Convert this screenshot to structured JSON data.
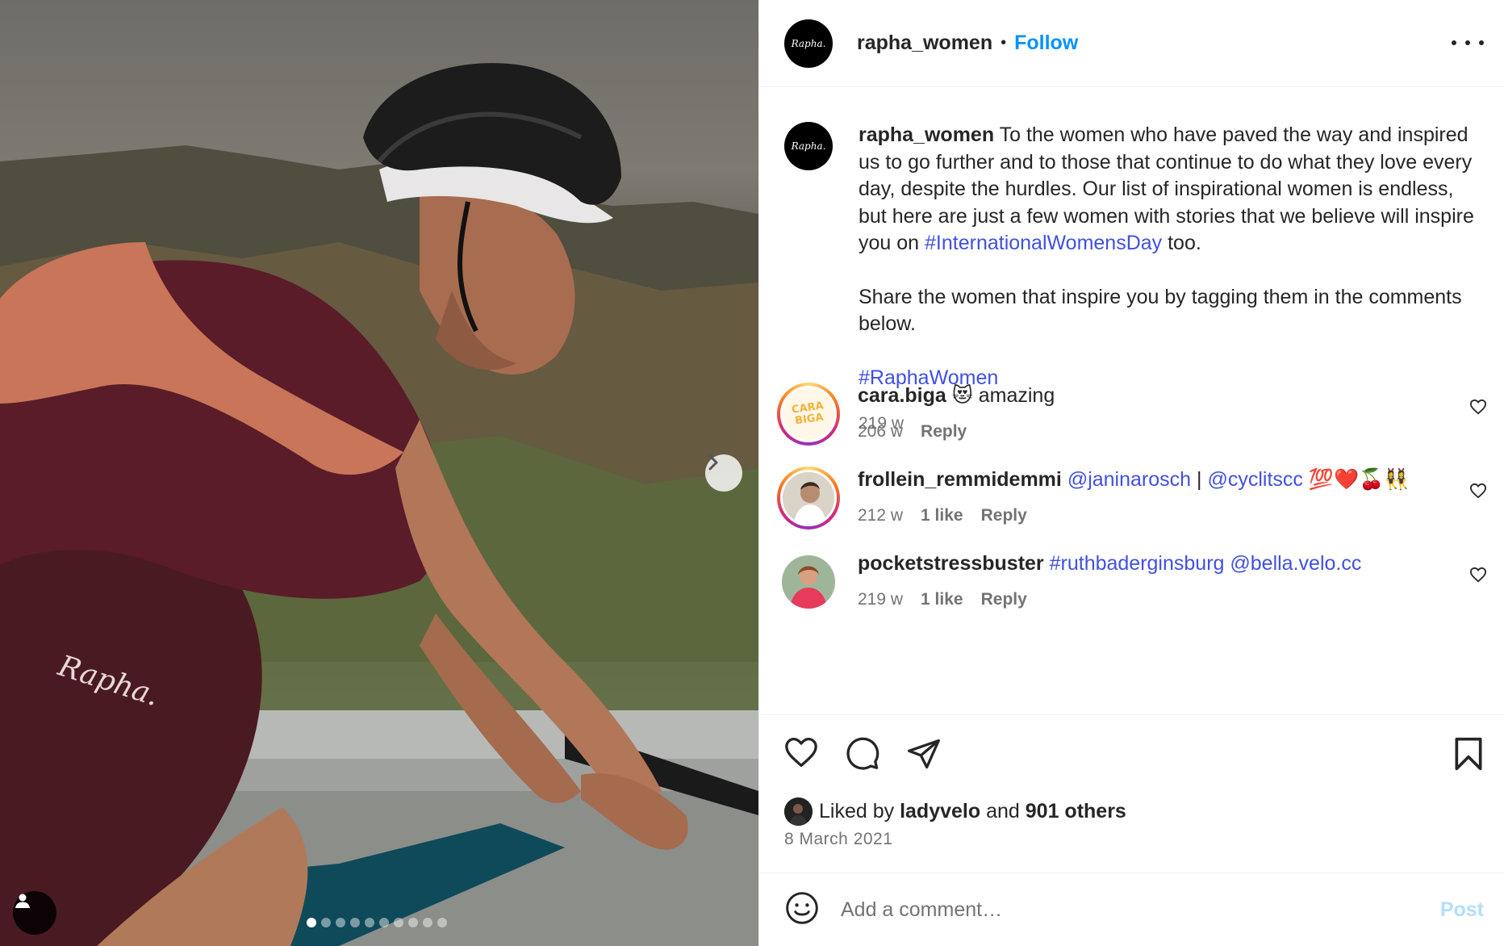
{
  "header": {
    "avatar_text": "Rapha.",
    "username": "rapha_women",
    "separator": "•",
    "follow_label": "Follow"
  },
  "caption": {
    "username": "rapha_women",
    "text_1": "To the women who have paved the way and inspired us to go further and to those that continue to do what they love every day, despite the hurdles. Our list of inspirational women is endless, but here are just a few women with stories that we believe will inspire you on",
    "hashtag_1": "#InternationalWomensDay",
    "text_1_end": "too.",
    "text_2": "Share the women that inspire you by tagging them in the comments below.",
    "hashtag_2": "#RaphaWomen",
    "age": "219 w"
  },
  "comments": [
    {
      "username": "cara.biga",
      "emoji": "😻",
      "text": "amazing",
      "age": "206 w",
      "likes": "",
      "reply_label": "Reply",
      "avatar_text": "CARA BIGA"
    },
    {
      "username": "frollein_remmidemmi",
      "mention_1": "@janinarosch",
      "divider": "|",
      "mention_2": "@cyclitscc",
      "emoji": "💯❤️🍒👯‍♀️",
      "age": "212 w",
      "likes": "1 like",
      "reply_label": "Reply"
    },
    {
      "username": "pocketstressbuster",
      "mention_1": "#ruthbaderginsburg",
      "mention_2": "@bella.velo.cc",
      "age": "219 w",
      "likes": "1 like",
      "reply_label": "Reply"
    }
  ],
  "actions": {
    "liked_by_prefix": "Liked by",
    "liked_by_user": "ladyvelo",
    "liked_by_and": "and",
    "liked_by_others": "901 others",
    "date": "8 March 2021"
  },
  "add_comment": {
    "placeholder": "Add a comment…",
    "post_label": "Post"
  },
  "media": {
    "carousel_count": 10,
    "carousel_active": 1,
    "brand_mark": "Rapha."
  },
  "colors": {
    "link": "#4150e0",
    "follow": "#0095f6",
    "post_disabled": "#b2dffc"
  }
}
